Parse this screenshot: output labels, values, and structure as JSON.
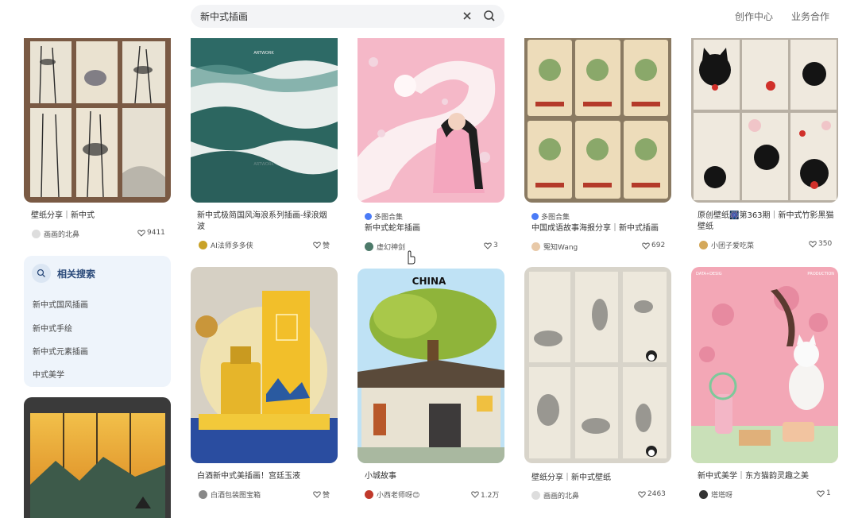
{
  "header": {
    "search_value": "新中式插画",
    "creator_center": "创作中心",
    "business": "业务合作"
  },
  "sidebar": {
    "related_title": "相关搜索",
    "related_items": [
      "新中式国风插画",
      "新中式手绘",
      "新中式元素插画",
      "中式美学"
    ]
  },
  "cards": [
    {
      "title": "壁纸分享｜新中式",
      "author": "画画的北鼻",
      "likes": "9411"
    },
    {
      "title": "新中式极简国风海浪系列插画-绿浪烟波",
      "author": "AI法师多多侠",
      "likes": "赞"
    },
    {
      "tag": "多图合集",
      "title": "新中式蛇年插画",
      "author": "虚幻神剑",
      "likes": "3"
    },
    {
      "tag": "多图合集",
      "title": "中国成语故事海报分享｜新中式插画",
      "author": "冤知Wang",
      "likes": "692"
    },
    {
      "title": "原创壁纸🎆第363期｜新中式竹影黑猫壁纸",
      "author": "小团子爱吃菜",
      "likes": "350"
    },
    {
      "title": "白酒新中式美插画！宫廷玉液",
      "author": "白酒包装图宝箱",
      "likes": "赞"
    },
    {
      "title": "小城故事",
      "author": "小西老师呀😊",
      "likes": "1.2万"
    },
    {
      "title": "壁纸分享｜新中式壁纸",
      "author": "画画的北鼻",
      "likes": "2463"
    },
    {
      "title": "新中式美学｜东方猫韵灵趣之美",
      "author": "塔塔呀",
      "likes": "1"
    }
  ],
  "image_texts": {
    "china": "CHINA",
    "artwork": "ARTWORK",
    "production": "PRODUCTION",
    "data_desig": "DATA+DESIG"
  },
  "colors": {
    "accent": "#4a7bf7",
    "panel": "#eef4fb"
  }
}
